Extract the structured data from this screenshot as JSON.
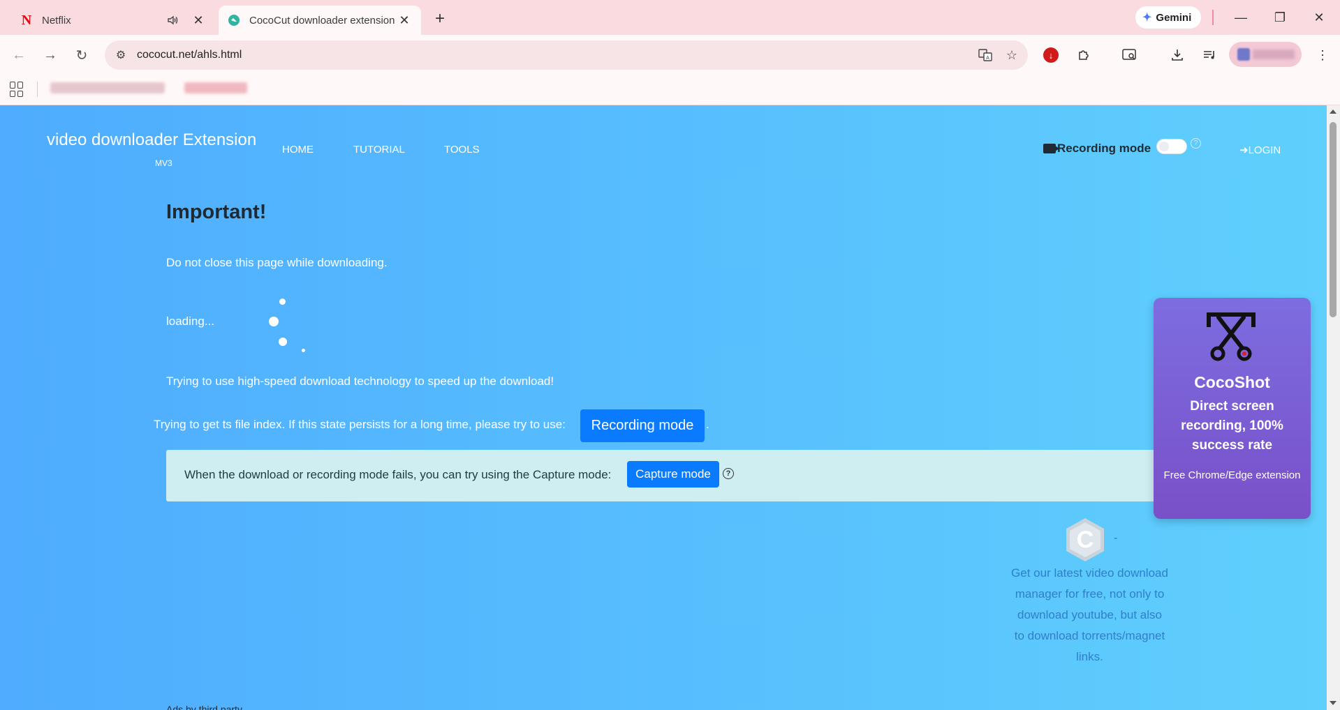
{
  "browser": {
    "tabs": [
      {
        "title": "Netflix",
        "favicon": "N"
      },
      {
        "title": "CocoCut downloader extension",
        "favicon": "cococut-icon"
      }
    ],
    "new_tab": "+",
    "gemini_label": "Gemini",
    "url": "cococut.net/ahls.html"
  },
  "page": {
    "brand": "video downloader Extension",
    "brand_tag": "MV3",
    "nav": [
      "HOME",
      "TUTORIAL",
      "TOOLS"
    ],
    "recording_mode_label": "Recording mode",
    "help_symbol": "?",
    "login": "LOGIN",
    "important_heading": "Important!",
    "warning": "Do not close this page while downloading.",
    "loading": "loading...",
    "high_speed": "Trying to use high-speed download technology to speed up the download!",
    "ts_index": "Trying to get ts file index. If this state persists for a long time, please try to use:",
    "recording_button": "Recording mode",
    "period": ".",
    "capture_text": "When the download or recording mode fails, you can try using the Capture mode:",
    "capture_button": "Capture mode",
    "promo_dash": "-",
    "promo_text": "Get our latest video download manager for free, not only to download youtube, but also to download torrents/magnet links.",
    "ads_label": "Ads by third party"
  },
  "cocoshot": {
    "title": "CocoShot",
    "subtitle": "Direct screen recording, 100% success rate",
    "footer": "Free Chrome/Edge extension"
  },
  "colors": {
    "page_gradient_start": "#4facfe",
    "page_gradient_end": "#5fd0fd",
    "button_blue": "#0a7bff",
    "card_purple": "#7950c8"
  }
}
